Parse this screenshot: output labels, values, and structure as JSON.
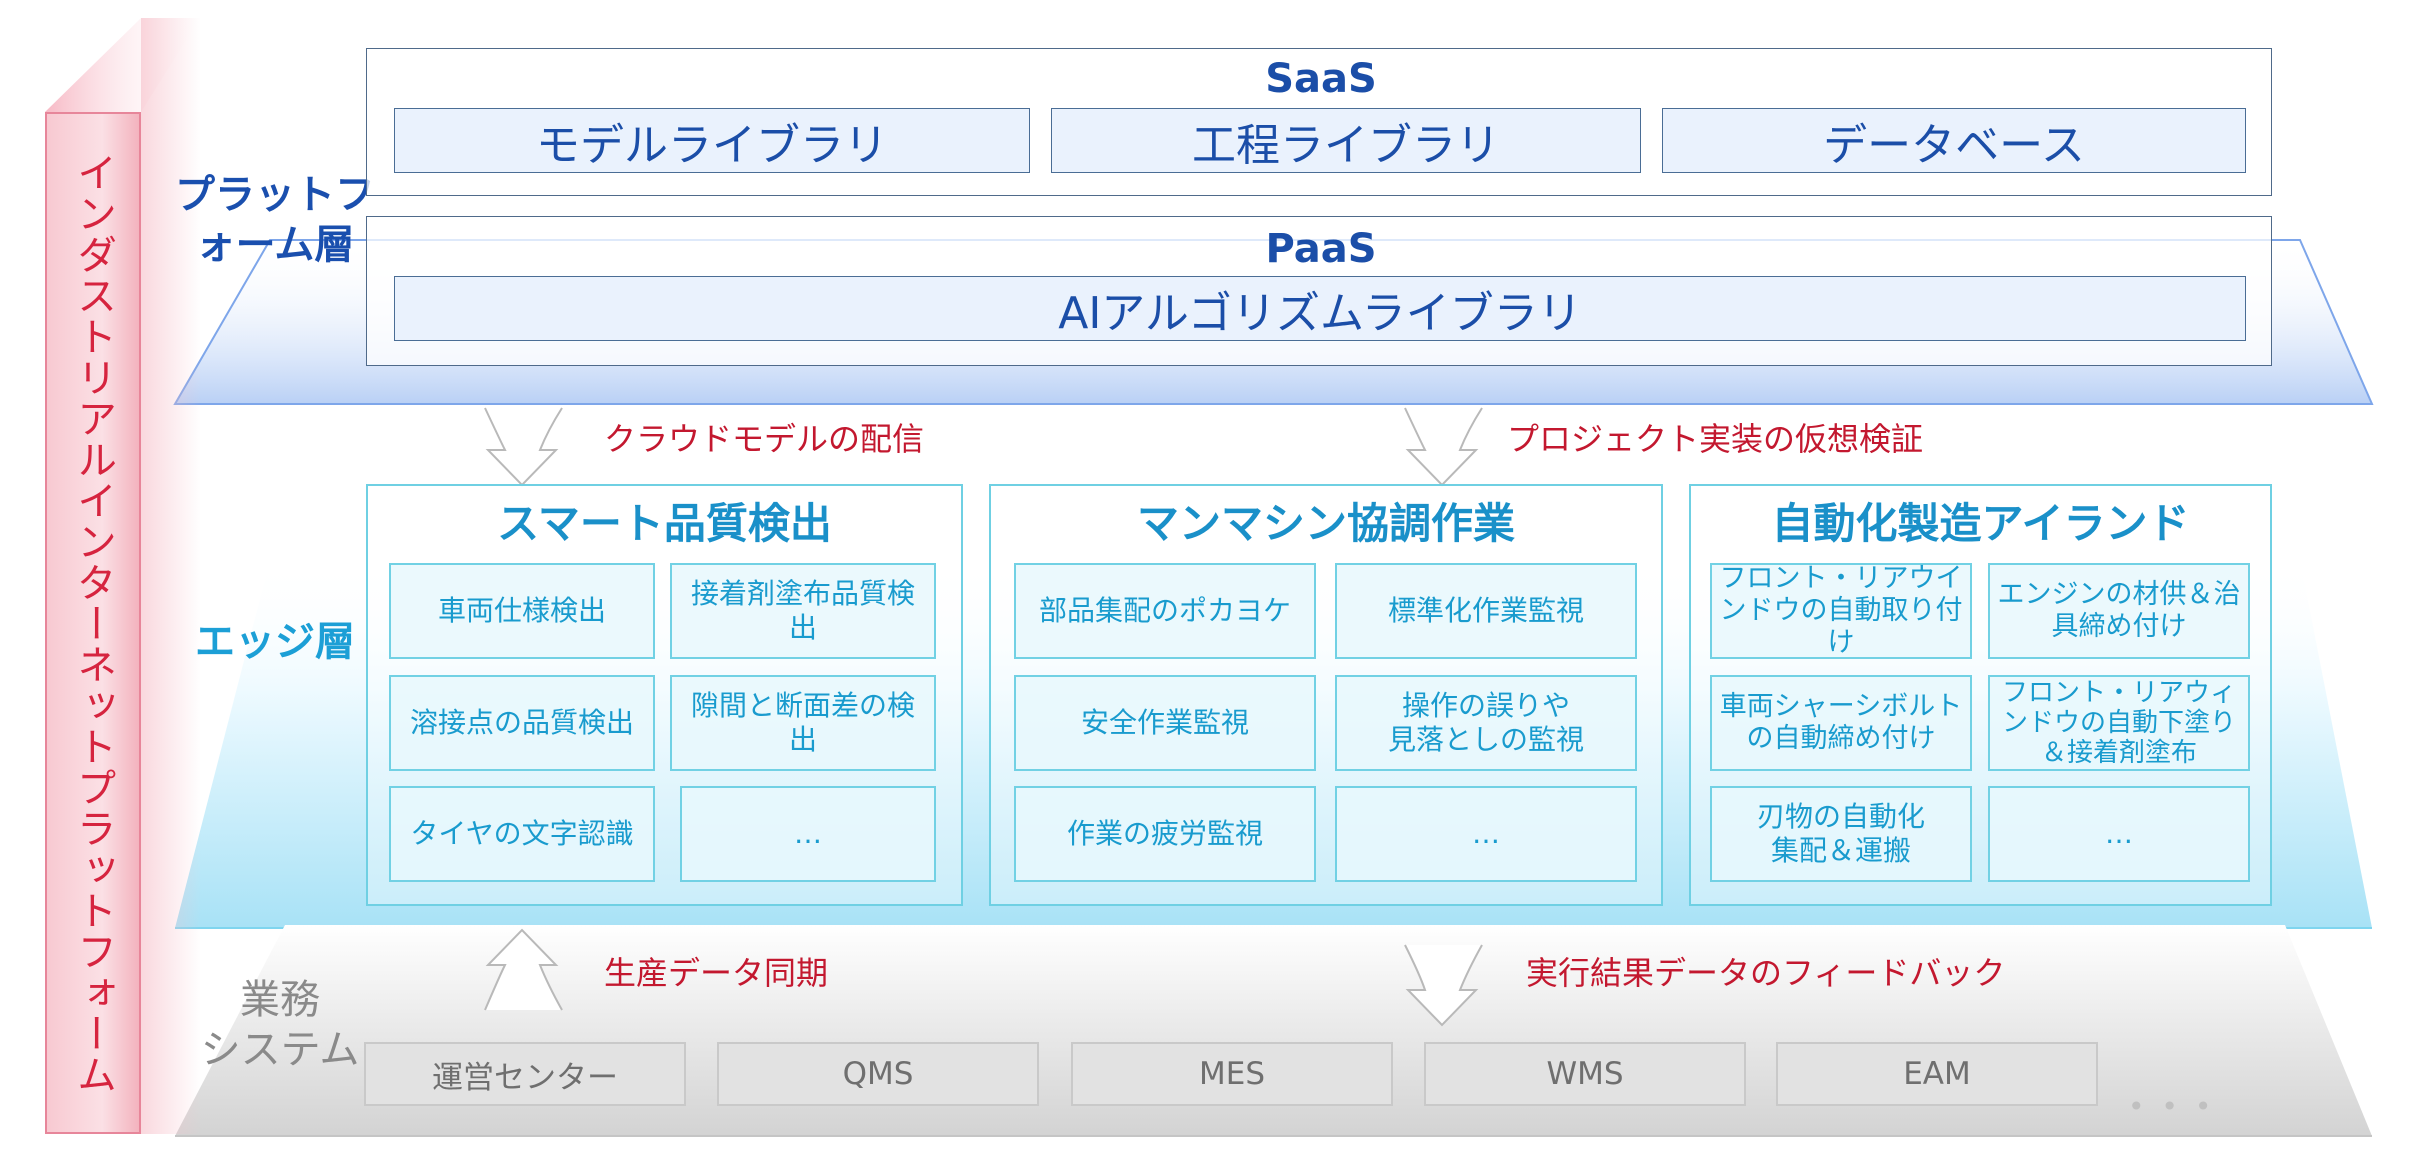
{
  "pillar": {
    "label": "インダストリアルインターネットプラットフォーム"
  },
  "platform": {
    "label": "プラットフォーム層",
    "saas": {
      "title": "SaaS",
      "items": [
        "モデルライブラリ",
        "工程ライブラリ",
        "データベース"
      ]
    },
    "paas": {
      "title": "PaaS",
      "items": [
        "AIアルゴリズムライブラリ"
      ]
    }
  },
  "edge": {
    "label": "エッジ層",
    "groups": [
      {
        "title": "スマート品質検出",
        "items": [
          "車両仕様検出",
          "接着剤塗布品質検出",
          "溶接点の品質検出",
          "隙間と断面差の検出",
          "タイヤの文字認識",
          "…"
        ]
      },
      {
        "title": "マンマシン協調作業",
        "items": [
          "部品集配のポカヨケ",
          "標準化作業監視",
          "安全作業監視",
          "操作の誤りや\n見落としの監視",
          "作業の疲労監視",
          "…"
        ]
      },
      {
        "title": "自動化製造アイランド",
        "items": [
          "フロント・リアウインドウの自動取り付け",
          "エンジンの材供＆治具締め付け",
          "車両シャーシボルトの自動締め付け",
          "フロント・リアウィンドウの自動下塗り＆接着剤塗布",
          "刃物の自動化\n集配＆運搬",
          "…"
        ]
      }
    ]
  },
  "business": {
    "label": "業務\nシステム",
    "items": [
      "運営センター",
      "QMS",
      "MES",
      "WMS",
      "EAM"
    ],
    "more": "• • •"
  },
  "flows": {
    "cloud_to_edge_left": "クラウドモデルの配信",
    "cloud_to_edge_right": "プロジェクト実装の仮想検証",
    "biz_to_edge_left": "生産データ同期",
    "edge_to_biz_right": "実行結果データのフィードバック"
  },
  "colors": {
    "platform_accent": "#1a4fae",
    "edge_accent": "#1c9fd6",
    "pillar_accent": "#d6243f",
    "flow_label": "#c3182f"
  }
}
